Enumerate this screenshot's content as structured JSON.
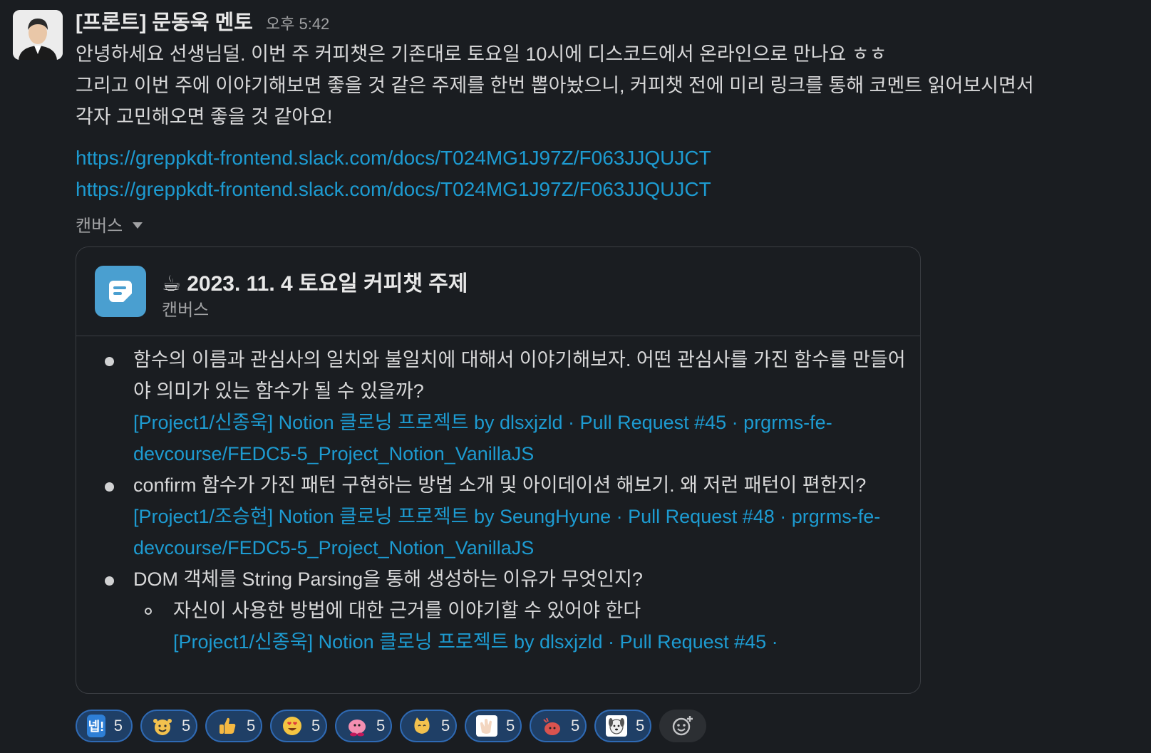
{
  "message": {
    "sender": "[프론트] 문동욱 멘토",
    "time": "오후 5:42",
    "lines": [
      "안녕하세요 선생님덜. 이번 주 커피챗은 기존대로 토요일 10시에 디스코드에서 온라인으로 만나요 ㅎㅎ",
      "그리고 이번 주에 이야기해보면 좋을 것 같은 주제를 한번 뽑아놨으니, 커피챗 전에 미리 링크를 통해 코멘트 읽어보시면서",
      "각자 고민해오면 좋을 것 같아요!"
    ],
    "links": [
      "https://greppkdt-frontend.slack.com/docs/T024MG1J97Z/F063JJQUJCT",
      "https://greppkdt-frontend.slack.com/docs/T024MG1J97Z/F063JJQUJCT"
    ],
    "canvas_toggle": "캔버스"
  },
  "canvas": {
    "title": "☕ 2023. 11. 4 토요일 커피챗 주제",
    "subtitle": "캔버스",
    "items": [
      {
        "text": "함수의 이름과 관심사의 일치와 불일치에 대해서 이야기해보자. 어떤 관심사를 가진 함수를 만들어야 의미가 있는 함수가 될 수 있을까?",
        "link": "[Project1/신종욱] Notion 클로닝 프로젝트 by dlsxjzld · Pull Request #45 · prgrms-fe-devcourse/FEDC5-5_Project_Notion_VanillaJS"
      },
      {
        "text": "confirm 함수가 가진 패턴 구현하는 방법 소개 및 아이데이션 해보기. 왜 저런 패턴이 편한지?",
        "link": "[Project1/조승현] Notion 클로닝 프로젝트 by SeungHyune · Pull Request #48 · prgrms-fe-devcourse/FEDC5-5_Project_Notion_VanillaJS"
      },
      {
        "text": "DOM 객체를 String Parsing을 통해 생성하는 이유가 무엇인지?",
        "sub": {
          "text": "자신이 사용한 방법에 대한 근거를 이야기할 수 있어야 한다",
          "link": "[Project1/신종욱] Notion 클로닝 프로젝트 by dlsxjzld · Pull Request #45 ·"
        }
      }
    ]
  },
  "reactions": [
    {
      "icon": "ne-text-emoji",
      "label": "넵!",
      "count": "5",
      "color": "#2e7fd6"
    },
    {
      "icon": "cheering-face-emoji",
      "count": "5",
      "color": "#f2c14e"
    },
    {
      "icon": "thumbs-up-emoji",
      "count": "5",
      "color": "#f5b942"
    },
    {
      "icon": "heart-eyes-emoji",
      "count": "5",
      "color": "#f4c542"
    },
    {
      "icon": "kirby-emoji",
      "count": "5",
      "color": "#f48fb1"
    },
    {
      "icon": "cat-emoji",
      "count": "5",
      "color": "#f2c14e"
    },
    {
      "icon": "clapping-hands-emoji",
      "count": "5",
      "color": "#f3d6c0"
    },
    {
      "icon": "red-blob-emoji",
      "count": "5",
      "color": "#d9534f"
    },
    {
      "icon": "dog-emoji",
      "count": "5",
      "color": "#eeeeee"
    }
  ],
  "add_reaction_icon": "add-reaction-icon"
}
